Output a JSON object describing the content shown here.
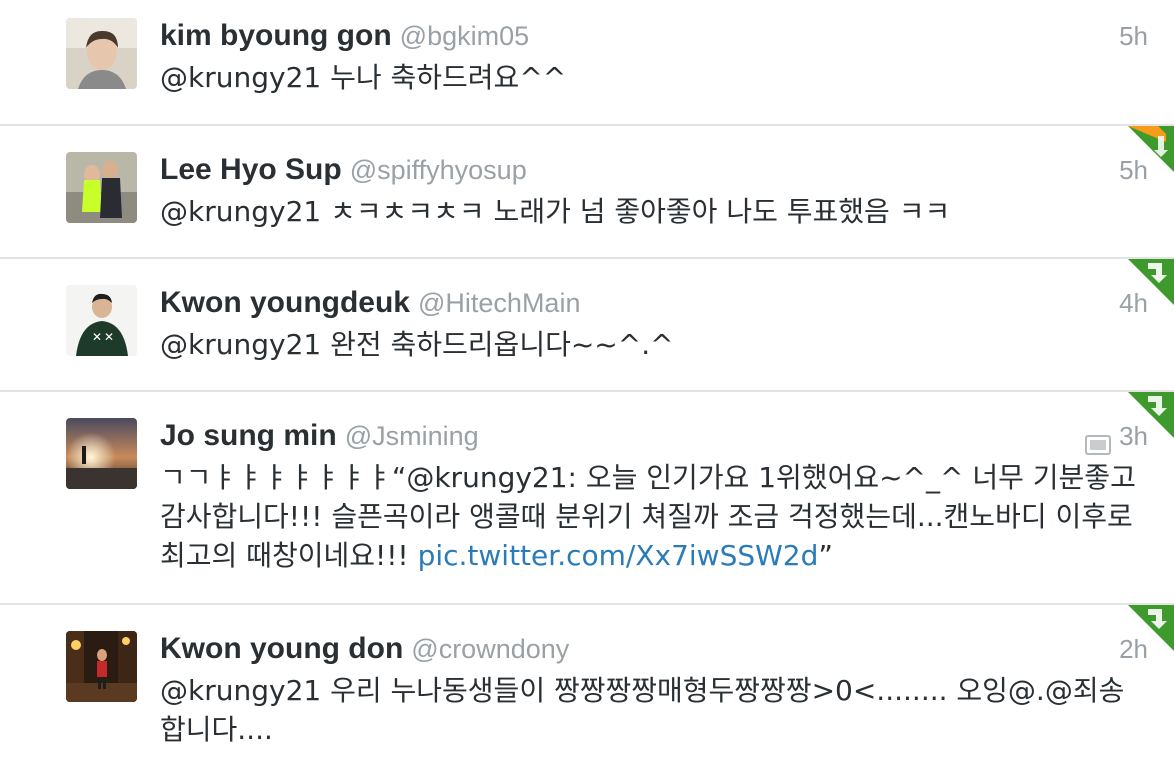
{
  "tweets": [
    {
      "fullname": "kim byoung gon",
      "handle": "@bgkim05",
      "time": "5h",
      "text": "@krungy21 누나 축하드려요^^",
      "corner": "none"
    },
    {
      "fullname": "Lee Hyo Sup",
      "handle": "@spiffyhyosup",
      "time": "5h",
      "text": "@krungy21 ㅊㅋㅊㅋㅊㅋ 노래가 넘 좋아좋아 나도 투표했음 ㅋㅋ",
      "corner": "favorited-retweeted",
      "corner_color_top": "#f59c1a",
      "corner_color_bottom": "#3f9a2e"
    },
    {
      "fullname": "Kwon youngdeuk",
      "handle": "@HitechMain",
      "time": "4h",
      "text": "@krungy21 완전 축하드리옵니다~~^.^",
      "corner": "retweeted",
      "corner_color": "#3f9a2e"
    },
    {
      "fullname": "Jo sung min",
      "handle": "@Jsmining",
      "time": "3h",
      "has_media_icon": true,
      "media_icon": "photo-icon",
      "text": "ㄱㄱㅑㅑㅑㅑㅑㅑㅑ“@krungy21: 오늘 인기가요 1위했어요~^_^ 너무 기분좋고 감사합니다!!! 슬픈곡이라 앵콜때 분위기 쳐질까 조금 걱정했는데...캔노바디 이후로 최고의 때창이네요!!! ",
      "link": "pic.twitter.com/Xx7iwSSW2d",
      "text_after": "”",
      "corner": "retweeted",
      "corner_color": "#3f9a2e"
    },
    {
      "fullname": "Kwon young don",
      "handle": "@crowndony",
      "time": "2h",
      "text": "@krungy21 우리 누나동생들이 짱짱짱짱매형두짱짱짱>0<........  오잉@.@죄송합니다....",
      "corner": "retweeted",
      "corner_color": "#3f9a2e"
    }
  ]
}
